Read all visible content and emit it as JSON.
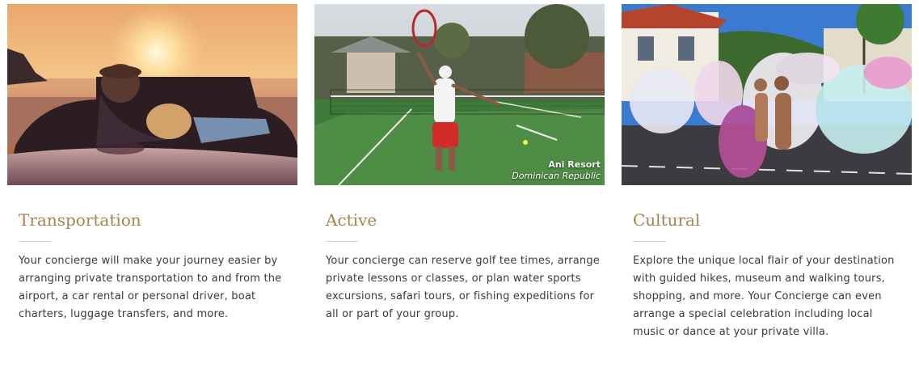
{
  "cards": [
    {
      "title": "Transportation",
      "body": "Your concierge will make your journey easier by arranging private transportation to and from the airport, a car rental or personal driver, boat charters, luggage transfers, and more.",
      "image": "sunset-convertible-car-photo"
    },
    {
      "title": "Active",
      "body": "Your concierge can reserve golf tee times, arrange private lessons or classes, or plan water sports excursions, safari tours, or fishing expeditions for all or part of your group.",
      "image": "tennis-player-court-photo",
      "caption": {
        "name": "Ani Resort",
        "location": "Dominican Republic"
      }
    },
    {
      "title": "Cultural",
      "body": "Explore the unique local flair of your destination with guided hikes, museum and walking tours, shopping, and more. Your Concierge can even arrange a special celebration including local music or dance at your private villa.",
      "image": "carnival-dancers-parade-photo"
    }
  ],
  "colors": {
    "title": "#a8834a",
    "body_text": "#3a3a3a",
    "divider": "#cfcfcf"
  }
}
